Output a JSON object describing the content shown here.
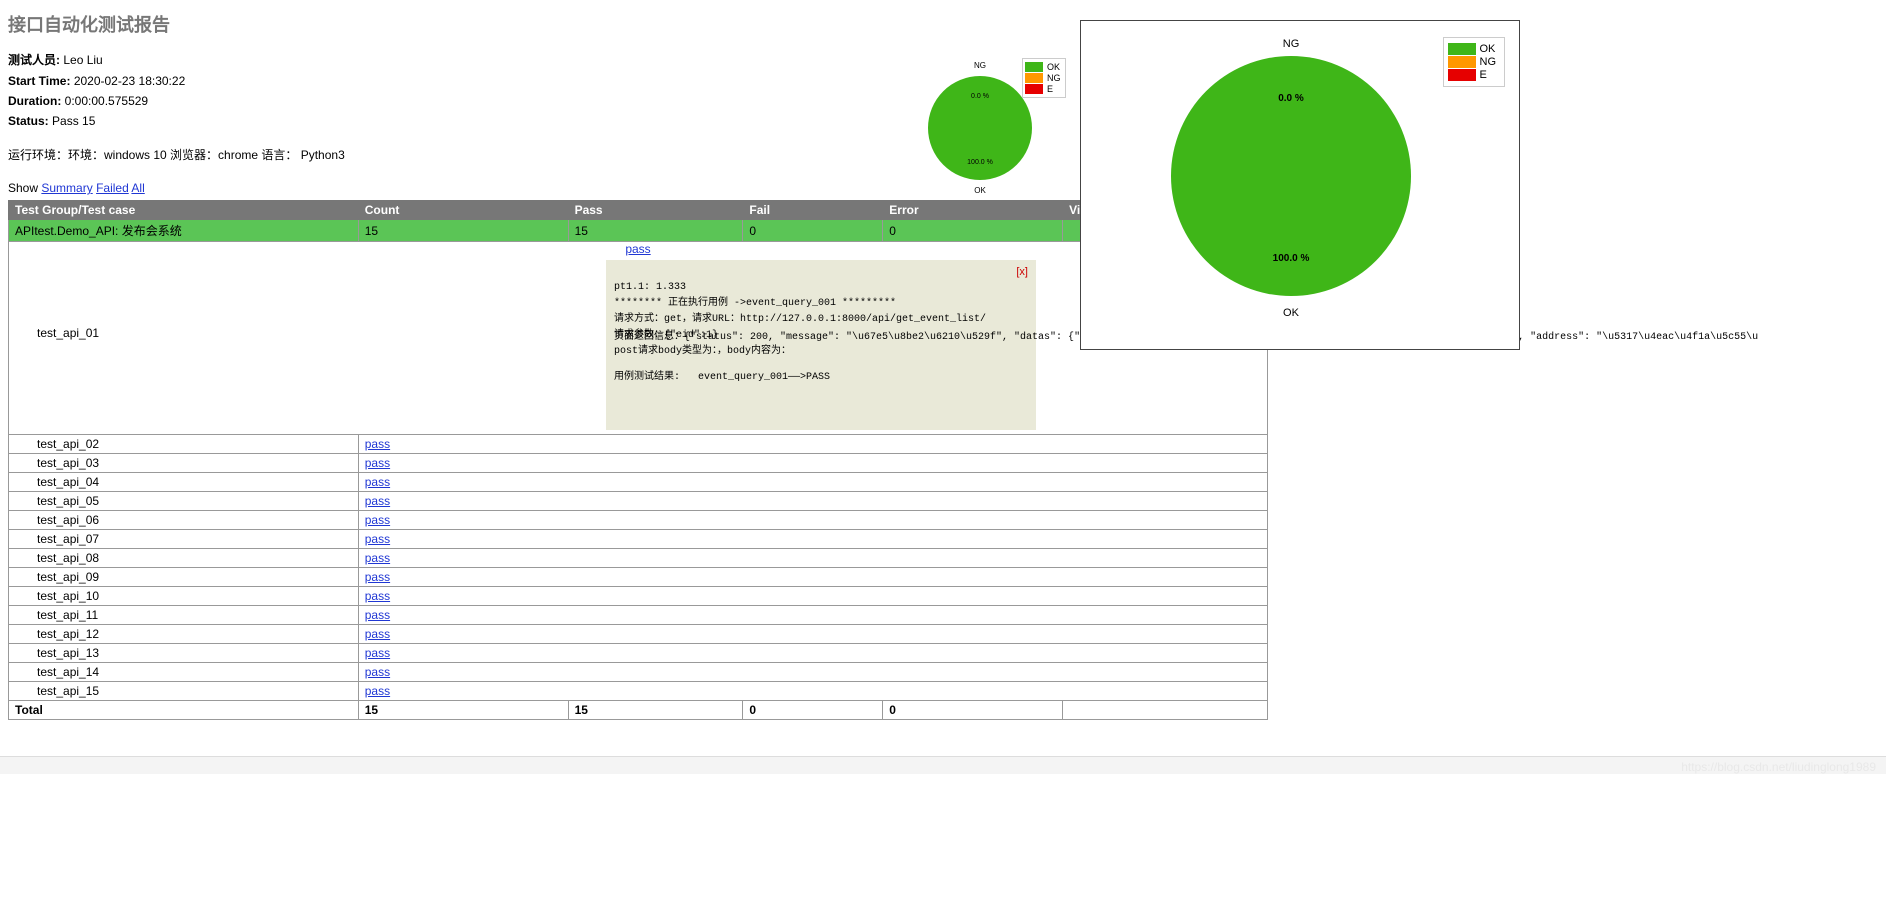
{
  "title": "接口自动化测试报告",
  "attrs": {
    "tester_label": "测试人员:",
    "tester_value": "Leo Liu",
    "start_label": "Start Time:",
    "start_value": "2020-02-23 18:30:22",
    "duration_label": "Duration:",
    "duration_value": "0:00:00.575529",
    "status_label": "Status:",
    "status_value": "Pass 15",
    "env": "运行环境：环境：windows 10 浏览器：chrome 语言： Python3"
  },
  "show": {
    "prefix": "Show",
    "summary": "Summary",
    "failed": "Failed",
    "all": "All"
  },
  "columns": {
    "name": "Test Group/Test case",
    "count": "Count",
    "pass": "Pass",
    "fail": "Fail",
    "error": "Error",
    "view": "View"
  },
  "group": {
    "name": "APItest.Demo_API: 发布会系统",
    "count": "15",
    "pass": "15",
    "fail": "0",
    "error": "0"
  },
  "detail": {
    "close": "[x]",
    "lines": [
      "pt1.1: 1.333",
      "******** 正在执行用例 ->event_query_001 *********",
      "请求方式：get，请求URL：http://127.0.0.1:8000/api/get_event_list/",
      "请求参数：{\"eid\":1}",
      "post请求body类型为：，body内容为：",
      "页面返回信息：{\"status\": 200, \"message\": \"\\u67e5\\u8be2\\u6210\\u529f\", \"datas\": {\"name\": \"\\u7ea2\\u7c73Pro\\u53d1\\u5e03\\u4f1a\", \"limit\": 2000, \"status\": true, \"address\": \"\\u5317\\u4eac\\u4f1a\\u5c55\\u",
      "用例测试结果:   event_query_001——>PASS"
    ]
  },
  "cases": [
    {
      "name": "test_api_01",
      "result": "pass",
      "expanded": true
    },
    {
      "name": "test_api_02",
      "result": "pass"
    },
    {
      "name": "test_api_03",
      "result": "pass"
    },
    {
      "name": "test_api_04",
      "result": "pass"
    },
    {
      "name": "test_api_05",
      "result": "pass"
    },
    {
      "name": "test_api_06",
      "result": "pass"
    },
    {
      "name": "test_api_07",
      "result": "pass"
    },
    {
      "name": "test_api_08",
      "result": "pass"
    },
    {
      "name": "test_api_09",
      "result": "pass"
    },
    {
      "name": "test_api_10",
      "result": "pass"
    },
    {
      "name": "test_api_11",
      "result": "pass"
    },
    {
      "name": "test_api_12",
      "result": "pass"
    },
    {
      "name": "test_api_13",
      "result": "pass"
    },
    {
      "name": "test_api_14",
      "result": "pass"
    },
    {
      "name": "test_api_15",
      "result": "pass"
    }
  ],
  "total": {
    "label": "Total",
    "count": "15",
    "pass": "15",
    "fail": "0",
    "error": "0"
  },
  "legend": {
    "ok": "OK",
    "ng": "NG",
    "e": "E"
  },
  "chart_labels": {
    "top": "NG",
    "pct_top": "0.0 %",
    "pct_bottom": "100.0 %",
    "bottom": "OK"
  },
  "colors": {
    "ok": "#3fb618",
    "ng": "#ff9800",
    "e": "#e60000"
  },
  "watermark": "https://blog.csdn.net/liudinglong1989",
  "chart_data": [
    {
      "type": "pie",
      "name": "small-summary-pie",
      "series": [
        {
          "name": "OK",
          "value": 100.0
        },
        {
          "name": "NG",
          "value": 0.0
        },
        {
          "name": "E",
          "value": 0.0
        }
      ],
      "labels": {
        "NG_pct": "0.0 %",
        "OK_pct": "100.0 %"
      }
    },
    {
      "type": "pie",
      "name": "large-summary-pie",
      "series": [
        {
          "name": "OK",
          "value": 100.0
        },
        {
          "name": "NG",
          "value": 0.0
        },
        {
          "name": "E",
          "value": 0.0
        }
      ],
      "labels": {
        "NG_pct": "0.0 %",
        "OK_pct": "100.0 %"
      }
    }
  ]
}
